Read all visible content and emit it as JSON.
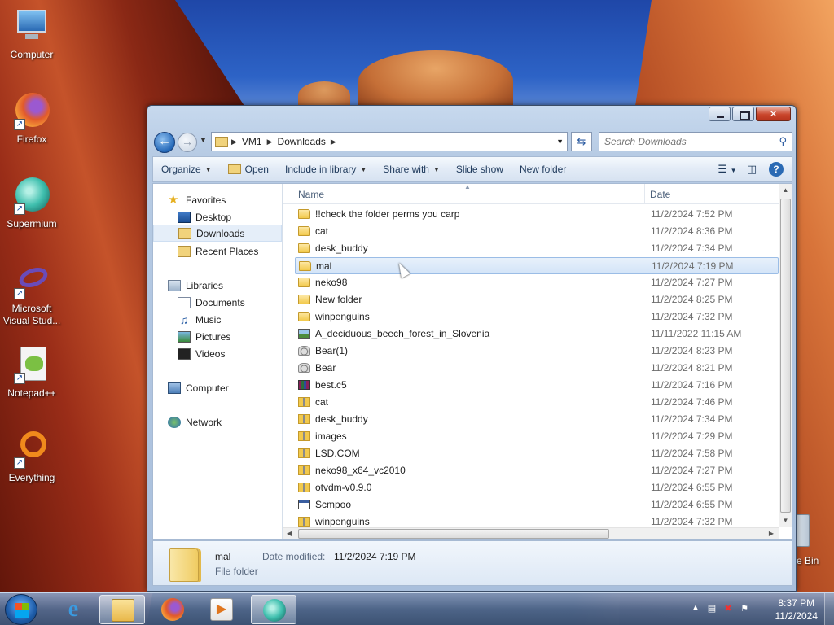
{
  "desktop": {
    "icons": [
      {
        "label": "Computer",
        "icon": "computer-icon"
      },
      {
        "label": "Firefox",
        "icon": "firefox-icon"
      },
      {
        "label": "Supermium",
        "icon": "supermium-icon"
      },
      {
        "label": "Microsoft Visual Stud...",
        "icon": "visual-studio-icon"
      },
      {
        "label": "Notepad++",
        "icon": "notepadpp-icon"
      },
      {
        "label": "Everything",
        "icon": "everything-icon"
      }
    ],
    "recycle_label": "e Bin"
  },
  "window": {
    "address": {
      "crumbs": [
        "VM1",
        "Downloads"
      ]
    },
    "search": {
      "placeholder": "Search Downloads"
    },
    "toolbar": {
      "organize": "Organize",
      "open": "Open",
      "include_in_library": "Include in library",
      "share_with": "Share with",
      "slide_show": "Slide show",
      "new_folder": "New folder"
    },
    "nav": {
      "favorites": "Favorites",
      "desktop": "Desktop",
      "downloads": "Downloads",
      "recent_places": "Recent Places",
      "libraries": "Libraries",
      "documents": "Documents",
      "music": "Music",
      "pictures": "Pictures",
      "videos": "Videos",
      "computer": "Computer",
      "network": "Network"
    },
    "columns": {
      "name": "Name",
      "date": "Date"
    },
    "files": [
      {
        "name": "!!check the folder perms you carp",
        "date": "11/2/2024 7:52 PM",
        "type": "folder"
      },
      {
        "name": "cat",
        "date": "11/2/2024 8:36 PM",
        "type": "folder"
      },
      {
        "name": "desk_buddy",
        "date": "11/2/2024 7:34 PM",
        "type": "folder"
      },
      {
        "name": "mal",
        "date": "11/2/2024 7:19 PM",
        "type": "folder",
        "selected": true
      },
      {
        "name": "neko98",
        "date": "11/2/2024 7:27 PM",
        "type": "folder"
      },
      {
        "name": "New folder",
        "date": "11/2/2024 8:25 PM",
        "type": "folder"
      },
      {
        "name": "winpenguins",
        "date": "11/2/2024 7:32 PM",
        "type": "folder"
      },
      {
        "name": "A_deciduous_beech_forest_in_Slovenia",
        "date": "11/11/2022 11:15 AM",
        "type": "image"
      },
      {
        "name": "Bear(1)",
        "date": "11/2/2024 8:23 PM",
        "type": "bear"
      },
      {
        "name": "Bear",
        "date": "11/2/2024 8:21 PM",
        "type": "bear"
      },
      {
        "name": "best.c5",
        "date": "11/2/2024 7:16 PM",
        "type": "rar"
      },
      {
        "name": "cat",
        "date": "11/2/2024 7:46 PM",
        "type": "zip"
      },
      {
        "name": "desk_buddy",
        "date": "11/2/2024 7:34 PM",
        "type": "zip"
      },
      {
        "name": "images",
        "date": "11/2/2024 7:29 PM",
        "type": "zip"
      },
      {
        "name": "LSD.COM",
        "date": "11/2/2024 7:58 PM",
        "type": "zip"
      },
      {
        "name": "neko98_x64_vc2010",
        "date": "11/2/2024 7:27 PM",
        "type": "zip"
      },
      {
        "name": "otvdm-v0.9.0",
        "date": "11/2/2024 6:55 PM",
        "type": "zip"
      },
      {
        "name": "Scmpoo",
        "date": "11/2/2024 6:55 PM",
        "type": "exe"
      },
      {
        "name": "winpenguins",
        "date": "11/2/2024 7:32 PM",
        "type": "zip"
      }
    ],
    "details": {
      "name": "mal",
      "modified_label": "Date modified:",
      "modified_value": "11/2/2024 7:19 PM",
      "type": "File folder"
    }
  },
  "taskbar": {
    "apps": [
      "explorer-icon",
      "internet-explorer-icon",
      "firefox-icon",
      "media-player-icon",
      "supermium-icon"
    ],
    "clock_time": "8:37 PM",
    "clock_date": "11/2/2024"
  }
}
